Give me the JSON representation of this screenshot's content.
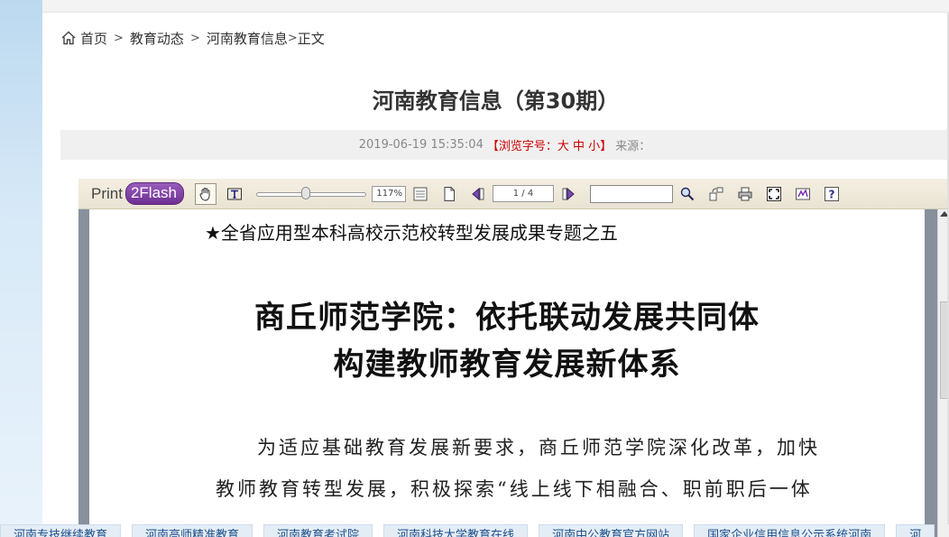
{
  "breadcrumb": {
    "home": "首页",
    "sep": ">",
    "item1": "教育动态",
    "item2": "河南教育信息",
    "item2_sep": ">",
    "current": "正文"
  },
  "article": {
    "title": "河南教育信息（第30期）",
    "datetime": "2019-06-19 15:35:04",
    "fontsize_open": "【浏览字号：",
    "fontsize_large": "大",
    "fontsize_medium": "中",
    "fontsize_small": "小",
    "fontsize_close": "】",
    "source_label": "来源："
  },
  "viewer": {
    "brand_print": "Print",
    "brand_flash": "2Flash",
    "zoom": "117%",
    "zoom_level": 0.45,
    "page_indicator": "1 / 4",
    "icons": [
      "hand-icon",
      "text-select-icon",
      "fit-width-icon",
      "single-page-icon",
      "prev-page-icon",
      "next-page-icon",
      "search-icon",
      "rotate-icon",
      "print-icon",
      "fullscreen-icon",
      "about-icon",
      "help-icon"
    ]
  },
  "document": {
    "subtitle": "★全省应用型本科高校示范校转型发展成果专题之五",
    "heading_line1": "商丘师范学院：依托联动发展共同体",
    "heading_line2": "构建教师教育发展新体系",
    "para_line1": "为适应基础教育发展新要求，商丘师范学院深化改革，加快",
    "para_line2": "教师教育转型发展，积极探索“线上线下相融合、职前职后一体"
  },
  "colors": {
    "fontsize_accent": "#cc0000",
    "brand_purple": "#6d2f91",
    "viewer_bg": "#87909c",
    "toolbar_bg": "#ece6d7"
  },
  "footer_links": [
    "河南专技继续教育",
    "河南高师精准教育",
    "河南教育考试院",
    "河南科技大学教育在线",
    "河南中公教育官方网站",
    "国家企业信用信息公示系统河南",
    "河"
  ]
}
